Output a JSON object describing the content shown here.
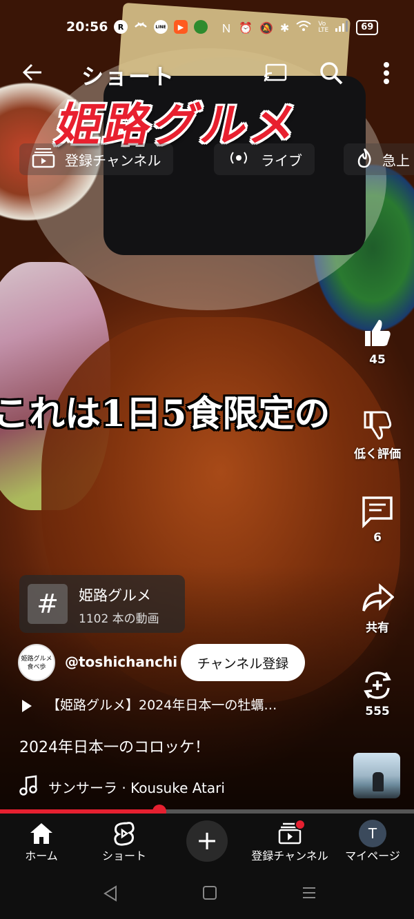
{
  "status_bar": {
    "time": "20:56",
    "left_icons": [
      "R",
      "LINE"
    ],
    "battery": "69"
  },
  "top_bar": {
    "title": "ショート"
  },
  "overlay": {
    "banner_text": "姫路グルメ",
    "subtitle_text": "これは1日5食限定の"
  },
  "feed_chips": [
    {
      "label": "登録チャンネル",
      "icon": "subscriptions-icon"
    },
    {
      "label": "ライブ",
      "icon": "live-icon"
    },
    {
      "label": "急上",
      "icon": "trending-icon"
    }
  ],
  "actions": {
    "like_count": "45",
    "dislike_label": "低く評価",
    "comment_count": "6",
    "share_label": "共有",
    "remix_count": "555"
  },
  "hashtag": {
    "name": "姫路グルメ",
    "video_count": "1102 本の動画"
  },
  "channel": {
    "avatar_text": "姫路グルメ 食べ歩",
    "handle": "@toshichanchi",
    "subscribe_label": "チャンネル登録"
  },
  "video": {
    "title": "【姫路グルメ】2024年日本一の牡蠣…",
    "description": "2024年日本一のコロッケ！",
    "music": "サンサーラ · Kousuke Atari",
    "progress": 0.385
  },
  "bottom_nav": {
    "home": "ホーム",
    "shorts": "ショート",
    "subscriptions": "登録チャンネル",
    "mypage": "マイページ",
    "mypage_avatar": "T"
  },
  "colors": {
    "accent": "#e52030",
    "banner": "#e8202f"
  }
}
